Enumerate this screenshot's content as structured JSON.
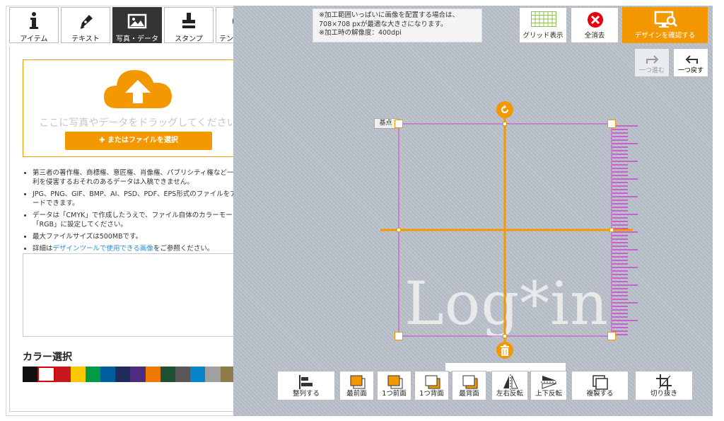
{
  "left_tabs": [
    {
      "label": "アイテム",
      "icon": "info-icon"
    },
    {
      "label": "テキスト",
      "icon": "pen-icon"
    },
    {
      "label": "写真・データ",
      "icon": "image-icon"
    },
    {
      "label": "スタンプ",
      "icon": "stamp-icon"
    },
    {
      "label": "テンプレート",
      "icon": "compass-icon"
    }
  ],
  "upload": {
    "drop_text": "ここに写真やデータをドラッグしてください",
    "select_label": "またはファイルを選択",
    "select_plus": "✚"
  },
  "notes": {
    "item1": "第三者の著作権、商標権、意匠権、肖像権、パブリシティ権など一切の権利を侵害するおそれのあるデータは入稿できません。",
    "item2": "JPG、PNG、GIF、BMP、AI、PSD、PDF、EPS形式のファイルをアップロードできます。",
    "item3": "データは「CMYK」で作成したうえで、ファイル自体のカラーモードは「RGB」に設定してください。",
    "item4": "最大ファイルサイズは500MBです。",
    "item5_pre": "詳細は",
    "item5_link": "デザインツールで使用できる画像",
    "item5_post": "をご参照ください。"
  },
  "color_title": "カラー選択",
  "colors": [
    "#111111",
    "#ffffff",
    "#c8161d",
    "#fcc800",
    "#009944",
    "#005e9c",
    "#1d2c5b",
    "#4b2c7e",
    "#ee7800",
    "#1e5034",
    "#595757",
    "#0686c9",
    "#9fa0a0",
    "#8e7c4b",
    "#e5709e"
  ],
  "info": {
    "line1": "※加工範囲いっぱいに画像を配置する場合は、",
    "line2": "708×708 pxが最適な大きさになります。",
    "line3": "※加工時の解像度：400dpi"
  },
  "top_buttons": {
    "grid": "グリッド表示",
    "clear": "全消去",
    "confirm": "デザインを確認する"
  },
  "undo": {
    "redo_label": "一つ進む",
    "undo_label": "一つ戻す"
  },
  "canvas": {
    "base_point": "基点",
    "logo_text": "Log*in"
  },
  "bottom_buttons": {
    "align": "整列する",
    "front_most": "最前面",
    "front_one": "1つ前面",
    "back_one": "1つ背面",
    "back_most": "最背面",
    "flip_h": "左右反転",
    "flip_v": "上下反転",
    "duplicate": "複製する",
    "crop": "切り抜き"
  },
  "accent": "#f39800",
  "guide_color": "#cc44cc"
}
